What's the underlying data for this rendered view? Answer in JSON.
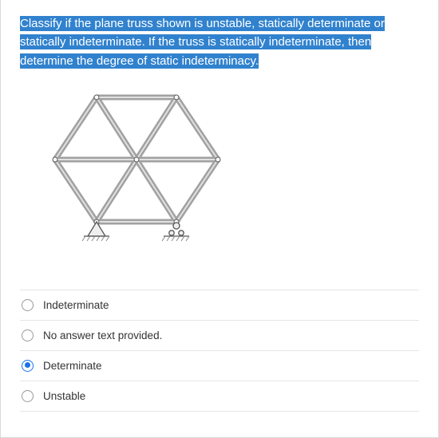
{
  "question_text": "Classify if the plane truss shown is unstable, statically determinate or statically indeterminate. If the truss is statically indeterminate, then determine the degree of static indeterminacy.",
  "options": [
    {
      "label": "Indeterminate",
      "selected": false
    },
    {
      "label": "No answer text provided.",
      "selected": false
    },
    {
      "label": "Determinate",
      "selected": true
    },
    {
      "label": "Unstable",
      "selected": false
    }
  ]
}
